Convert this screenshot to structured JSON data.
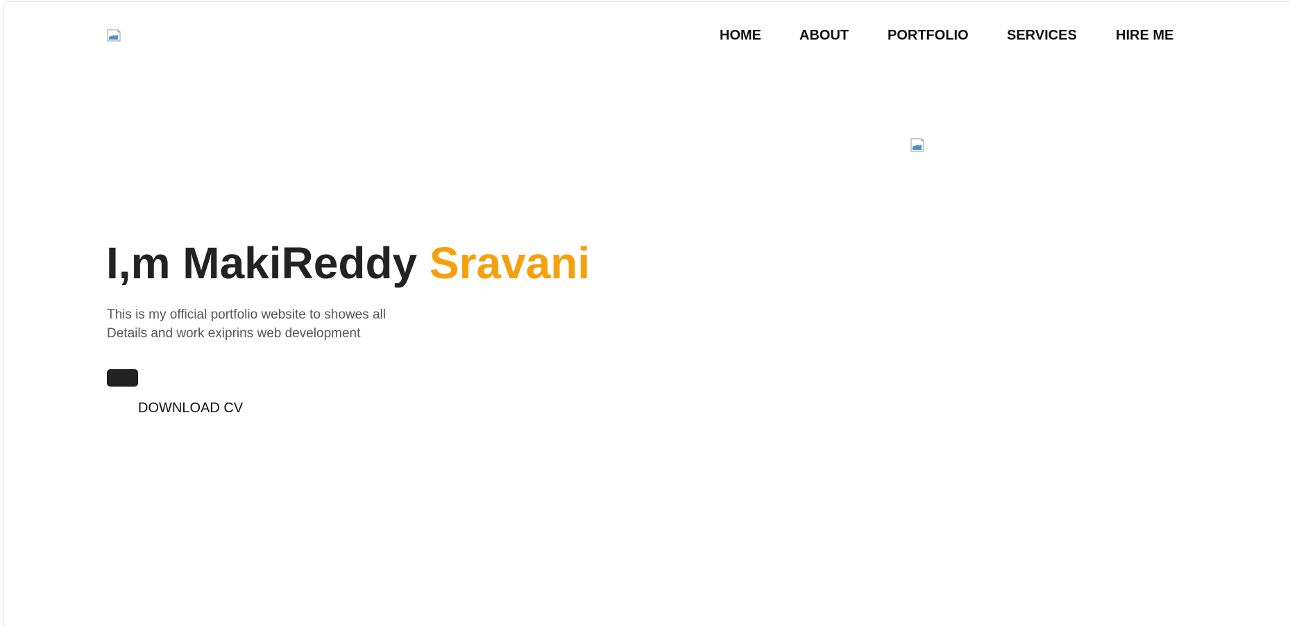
{
  "nav": {
    "items": [
      {
        "label": "HOME"
      },
      {
        "label": "ABOUT"
      },
      {
        "label": "PORTFOLIO"
      },
      {
        "label": "SERVICES"
      },
      {
        "label": "HIRE ME"
      }
    ]
  },
  "hero": {
    "title_prefix": "I,m MakiReddy ",
    "title_highlight": "Sravani",
    "description_line1": "This is my official portfolio website to showes all",
    "description_line2": "Details and work exiprins web development",
    "download_label": "DOWNLOAD CV"
  },
  "colors": {
    "accent": "#f5a00d",
    "title": "#222222",
    "text": "#555555",
    "button": "#222222"
  },
  "icons": {
    "logo": "broken-image-icon",
    "hero_image": "broken-image-icon"
  }
}
